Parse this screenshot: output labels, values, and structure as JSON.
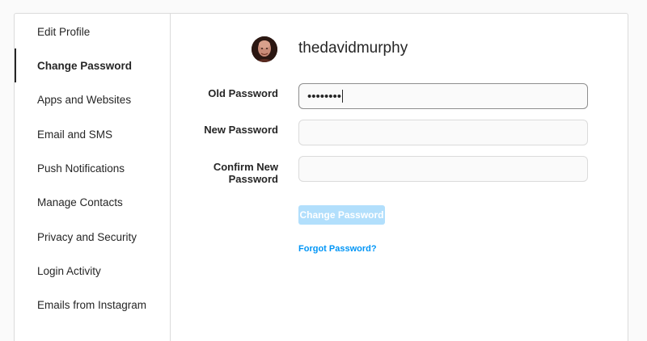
{
  "sidebar": {
    "items": [
      {
        "label": "Edit Profile",
        "active": false
      },
      {
        "label": "Change Password",
        "active": true
      },
      {
        "label": "Apps and Websites",
        "active": false
      },
      {
        "label": "Email and SMS",
        "active": false
      },
      {
        "label": "Push Notifications",
        "active": false
      },
      {
        "label": "Manage Contacts",
        "active": false
      },
      {
        "label": "Privacy and Security",
        "active": false
      },
      {
        "label": "Login Activity",
        "active": false
      },
      {
        "label": "Emails from Instagram",
        "active": false
      }
    ]
  },
  "profile": {
    "username": "thedavidmurphy",
    "avatar_icon": "profile-photo"
  },
  "form": {
    "old_password": {
      "label": "Old Password",
      "value": "••••••••"
    },
    "new_password": {
      "label": "New Password",
      "value": ""
    },
    "confirm_password": {
      "label_line1": "Confirm New",
      "label_line2": "Password",
      "value": ""
    },
    "submit_label": "Change Password",
    "forgot_label": "Forgot Password?"
  },
  "colors": {
    "accent": "#0095f6",
    "button_disabled": "#b2dffc",
    "border": "#dbdbdb",
    "text": "#262626"
  }
}
